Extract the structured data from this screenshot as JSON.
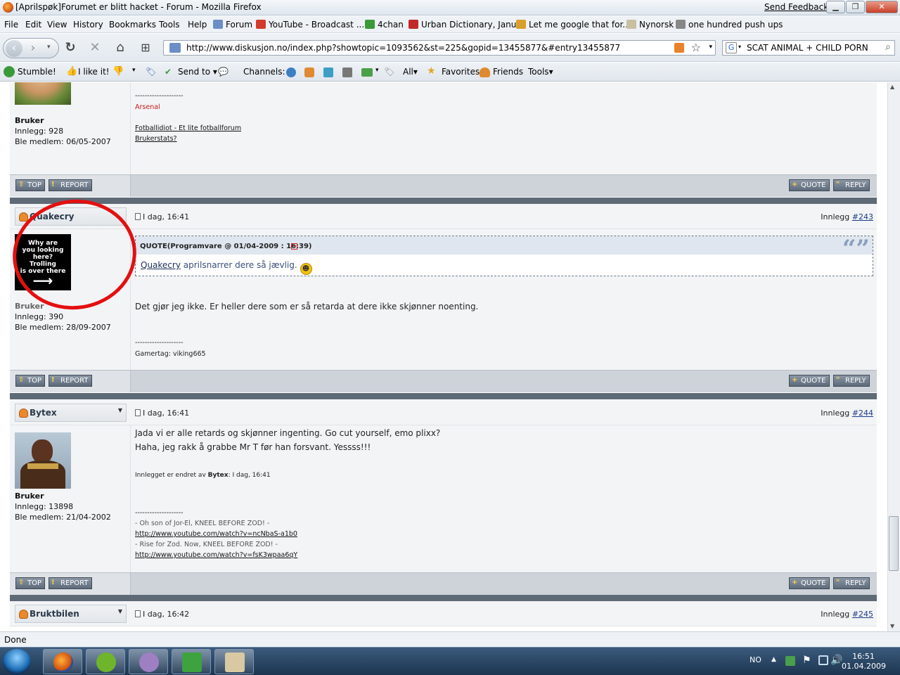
{
  "window": {
    "title": "[Aprilspøk]Forumet er blitt hacket - Forum - Mozilla Firefox",
    "send_feedback": "Send Feedback",
    "minimize": "▁",
    "restore": "❐",
    "close": "✕"
  },
  "menu": [
    "File",
    "Edit",
    "View",
    "History",
    "Bookmarks",
    "Tools",
    "Help"
  ],
  "bookmarks": [
    {
      "label": "Forum",
      "icon": "forum-icon",
      "color": "#6b8ec7"
    },
    {
      "label": "YouTube - Broadcast ...",
      "icon": "youtube-icon",
      "color": "#d23a2a"
    },
    {
      "label": "4chan",
      "icon": "4chan-icon",
      "color": "#3a9a3a"
    },
    {
      "label": "Urban Dictionary, Janu...",
      "icon": "urban-dictionary-icon",
      "color": "#c02a2a"
    },
    {
      "label": "Let me google that for...",
      "icon": "lmgtfy-icon",
      "color": "#d8a02a"
    },
    {
      "label": "Nynorsk",
      "icon": "folder-icon",
      "color": "#c9c0a0"
    },
    {
      "label": "one hundred push ups",
      "icon": "pushups-icon",
      "color": "#888888"
    }
  ],
  "nav": {
    "url": "http://www.diskusjon.no/index.php?showtopic=1093562&st=225&gopid=13455877&#entry13455877",
    "search_value": "SCAT ANIMAL + CHILD PORN"
  },
  "stumble": {
    "stumble": "Stumble!",
    "like": "I like it!",
    "send_to": "Send to",
    "channels": "Channels:",
    "all": "All",
    "favorites": "Favorites",
    "friends": "Friends",
    "tools": "Tools"
  },
  "post0": {
    "role": "Bruker",
    "posts": "Innlegg: 928",
    "member": "Ble medlem: 06/05-2007",
    "sig_line": "--------------------",
    "sig_red": "Arsenal",
    "sig_link1": "Fotballidiot - Et lite fotballforum",
    "sig_link2": "Brukerstats?"
  },
  "buttons": {
    "top": "TOP",
    "report": "REPORT",
    "quote": "QUOTE",
    "reply": "REPLY"
  },
  "post243": {
    "username": "Quakecry",
    "date": "I dag, 16:41",
    "number_label": "Innlegg",
    "number": "#243",
    "avatar_lines": [
      "Why are",
      "you looking",
      "here?",
      "Trolling",
      "is over there"
    ],
    "role_partial": "Bruker",
    "posts": "Innlegg: 390",
    "member": "Ble medlem: 28/09-2007",
    "quote_header": "QUOTE(Programvare @ 01/04-2009 : 16:39)",
    "quote_user": "Quakecry",
    "quote_text": " aprilsnarrer dere så jævlig.",
    "quote_marks": "“”",
    "body": "Det gjør jeg ikke. Er heller dere som er så retarda at dere ikke skjønner noenting.",
    "sig_line": "--------------------",
    "sig": "Gamertag: viking665"
  },
  "post244": {
    "username": "Bytex",
    "date": "I dag, 16:41",
    "number_label": "Innlegg",
    "number": "#244",
    "role": "Bruker",
    "posts": "Innlegg: 13898",
    "member": "Ble medlem: 21/04-2002",
    "body1": "Jada vi er alle retards og skjønner ingenting. Go cut yourself, emo plixx?",
    "body2": "Haha, jeg rakk å grabbe Mr T før han forsvant. Yessss!!!",
    "edited_prefix": "Innlegget er endret av ",
    "edited_by": "Bytex",
    "edited_suffix": ": I dag, 16:41",
    "sig_line": "--------------------",
    "sig1": "- Oh son of Jor-El, KNEEL BEFORE ZOD! -",
    "sig_link1": "http://www.youtube.com/watch?v=ncNbaS-a1b0",
    "sig2": "- Rise for Zod. Now, KNEEL BEFORE ZOD! -",
    "sig_link2": "http://www.youtube.com/watch?v=fsK3wpaa6qY"
  },
  "post245": {
    "username": "Bruktbilen",
    "date": "I dag, 16:42",
    "number_label": "Innlegg",
    "number": "#245"
  },
  "status": "Done",
  "taskbar": {
    "lang": "NO",
    "time": "16:51",
    "date": "01.04.2009"
  },
  "colors": {
    "annotation_circle": "#e31010",
    "sig_red": "#d01818",
    "separator": "#5e6a76"
  }
}
